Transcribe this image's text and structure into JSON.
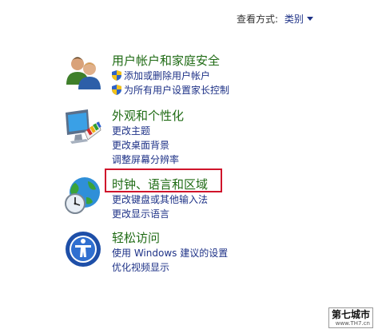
{
  "view_by": {
    "label": "查看方式:",
    "selected": "类别"
  },
  "categories": [
    {
      "title": "用户帐户和家庭安全",
      "links": [
        "添加或删除用户帐户",
        "为所有用户设置家长控制"
      ]
    },
    {
      "title": "外观和个性化",
      "links": [
        "更改主题",
        "更改桌面背景",
        "调整屏幕分辨率"
      ]
    },
    {
      "title": "时钟、语言和区域",
      "links": [
        "更改键盘或其他输入法",
        "更改显示语言"
      ]
    },
    {
      "title": "轻松访问",
      "links": [
        "使用 Windows 建议的设置",
        "优化视频显示"
      ]
    }
  ],
  "watermark": {
    "text": "第七城市",
    "sub": "www.TH7.cn"
  },
  "colors": {
    "title_green": "#1f6b14",
    "link_blue": "#1e3287",
    "highlight_red": "#d0142b"
  }
}
